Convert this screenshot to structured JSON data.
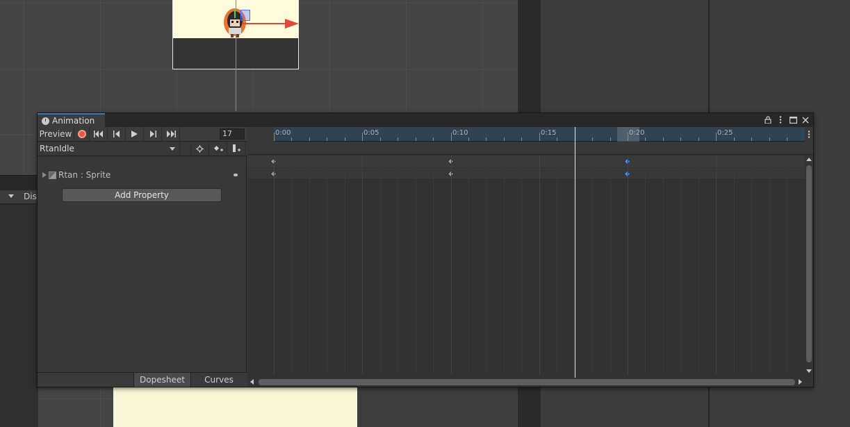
{
  "window": {
    "tab_title": "Animation"
  },
  "toolbar": {
    "preview_label": "Preview",
    "frame_value": "17"
  },
  "clip": {
    "selected": "RtanIdle"
  },
  "properties": [
    {
      "label": "Rtan : Sprite"
    }
  ],
  "add_property_label": "Add Property",
  "bottom_tabs": {
    "dopesheet": "Dopesheet",
    "curves": "Curves"
  },
  "background": {
    "partial_label": "Disp"
  },
  "timeline": {
    "ticks": [
      {
        "label": "0:00",
        "frame": 0
      },
      {
        "label": "0:05",
        "frame": 5
      },
      {
        "label": "0:10",
        "frame": 10
      },
      {
        "label": "0:15",
        "frame": 15
      },
      {
        "label": "0:20",
        "frame": 20
      },
      {
        "label": "0:25",
        "frame": 25
      }
    ],
    "current_frame": 17,
    "keyframes": [
      {
        "frame": 0,
        "selected": false
      },
      {
        "frame": 10,
        "selected": false
      },
      {
        "frame": 20,
        "selected": true
      }
    ]
  },
  "colors": {
    "record": "#e95a3c",
    "selected_key": "#4f8ae0",
    "ruler": "#2f4352",
    "tab_accent": "#3a79bb"
  },
  "icons": [
    "clock-icon",
    "lock-icon",
    "kebab-menu-icon",
    "maximize-icon",
    "close-icon",
    "record-icon",
    "first-key-icon",
    "prev-key-icon",
    "play-icon",
    "next-key-icon",
    "last-key-icon",
    "filter-icon",
    "add-keyframe-icon",
    "add-event-icon",
    "sprite-icon"
  ]
}
